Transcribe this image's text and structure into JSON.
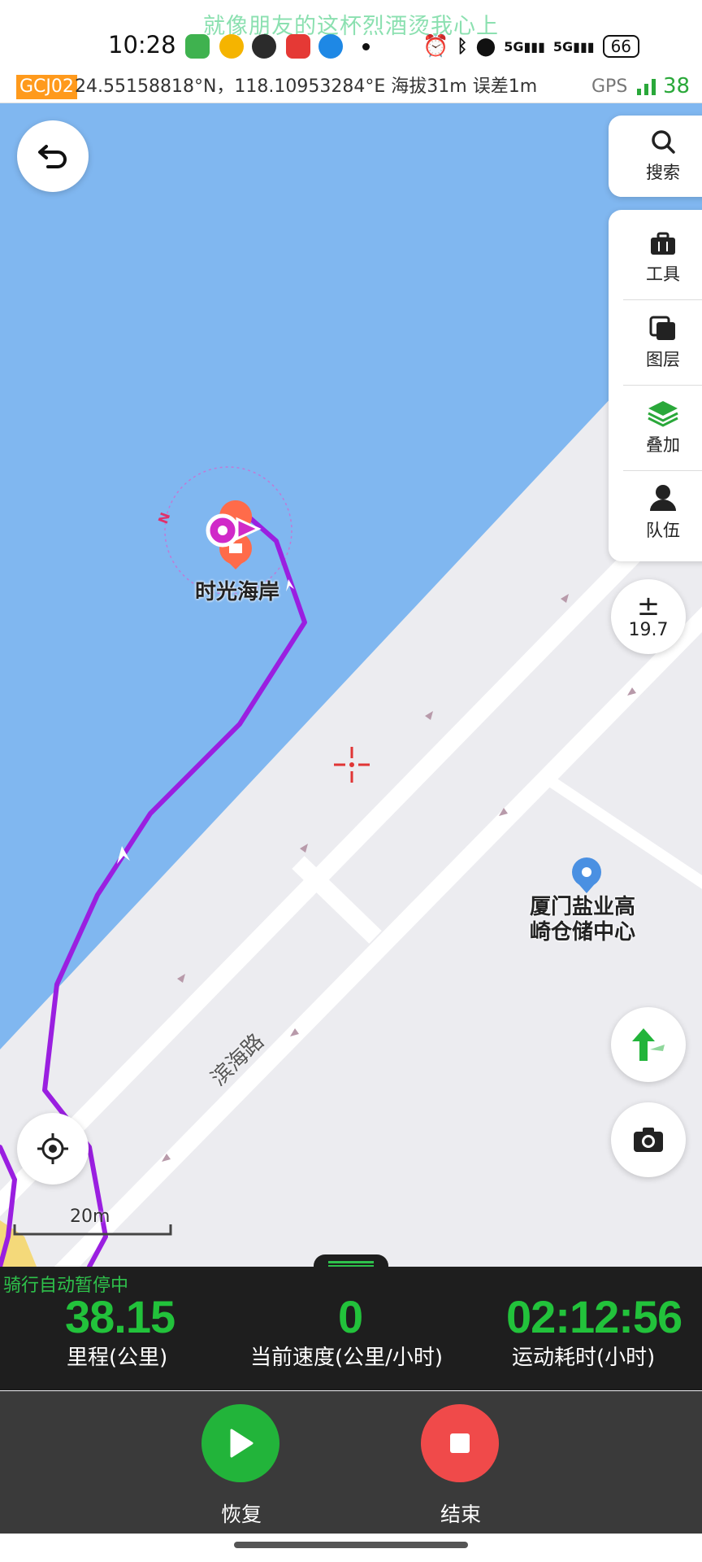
{
  "status_bar": {
    "lyric": "就像朋友的这杯烈酒烫我心上",
    "time": "10:28",
    "signal1": "5G",
    "signal2": "5G",
    "battery": "66"
  },
  "gps_bar": {
    "coord_system": "GCJ02",
    "coordinates": "24.55158818°N，118.10953284°E 海拔31m 误差1m",
    "gps_label": "GPS",
    "satellites": "38"
  },
  "map": {
    "poi_label": "时光海岸",
    "poi2_label_line1": "厦门盐业高",
    "poi2_label_line2": "崎仓储中心",
    "road_label": "滨海路",
    "compass_letter": "N",
    "scale_label": "20m",
    "zoom_level": "19.7"
  },
  "toolbar": {
    "search_label": "搜索",
    "tools_label": "工具",
    "layers_label": "图层",
    "overlay_label": "叠加",
    "team_label": "队伍"
  },
  "stats": {
    "auto_pause": "骑行自动暂停中",
    "distance_value": "38.15",
    "distance_label": "里程(公里)",
    "speed_value": "0",
    "speed_label": "当前速度(公里/小时)",
    "time_value": "02:12:56",
    "time_label": "运动耗时(小时)"
  },
  "actions": {
    "resume_label": "恢复",
    "end_label": "结束"
  },
  "colors": {
    "water": "#80b7f0",
    "land": "#ececf0",
    "track": "#9a1fe0",
    "stat_green": "#22c23b",
    "resume_green": "#22b43a",
    "end_red": "#f04a4a",
    "gcj_orange": "#ff9a1c"
  }
}
